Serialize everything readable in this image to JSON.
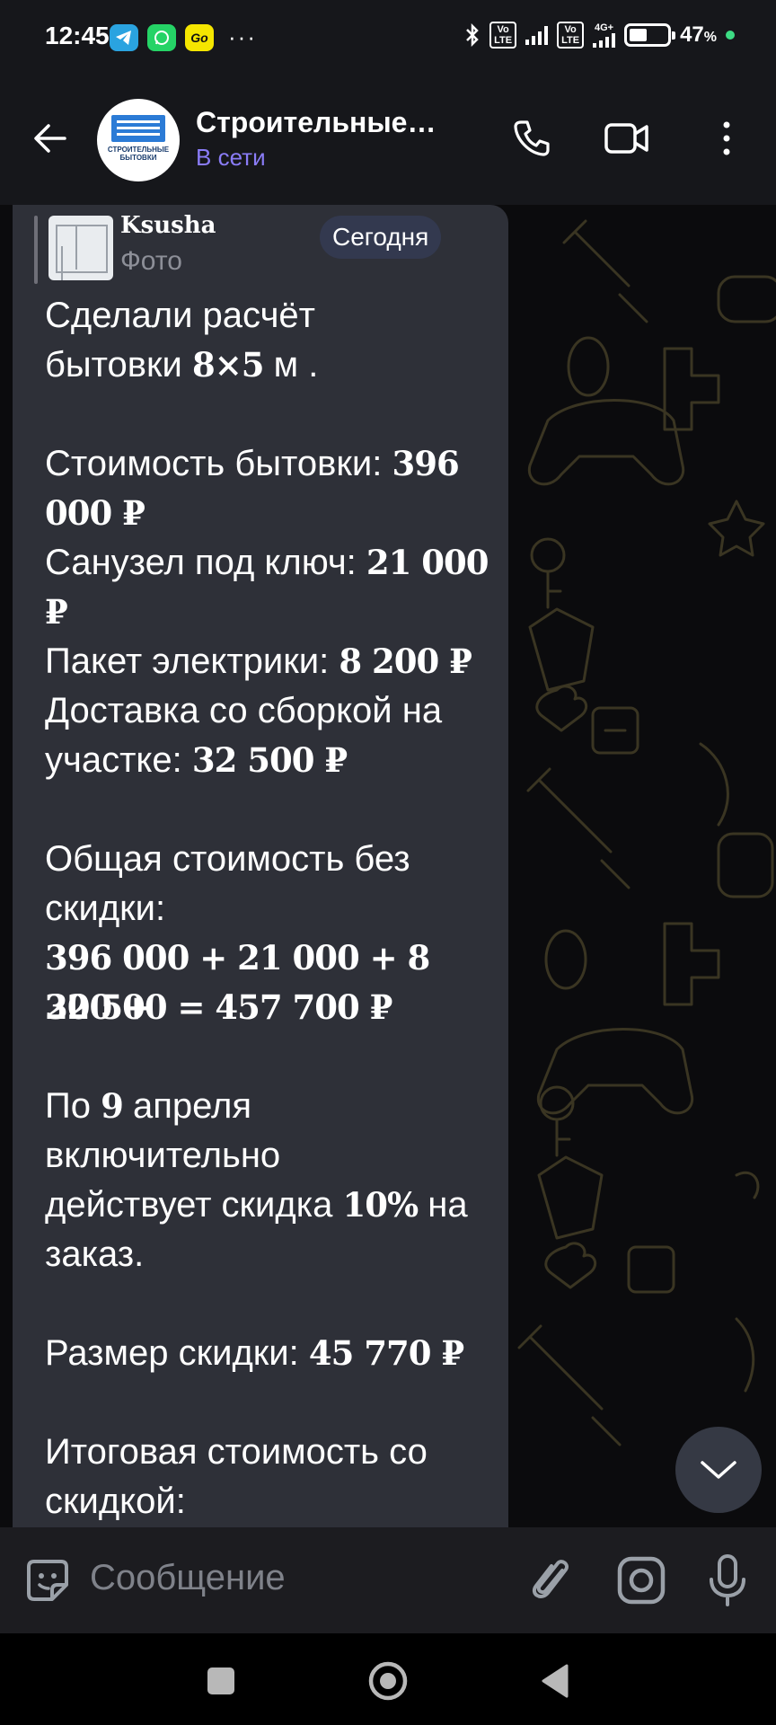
{
  "status_bar": {
    "time": "12:45",
    "battery_percent": "47",
    "battery_suffix": "%",
    "battery_level": 0.47,
    "volte_1": "Vo\nLTE",
    "volte_2": "Vo\nLTE",
    "network": "4G+",
    "app_icons": [
      "telegram-icon",
      "whatsapp-icon",
      "go-icon"
    ],
    "overflow": "···"
  },
  "header": {
    "title": "Строительные…",
    "status": "В сети",
    "avatar_text": "СТРОИТЕЛЬНЫЕ БЫТОВКИ",
    "accent_color": "#8a7cf7"
  },
  "message": {
    "reply": {
      "author": "Ksusha",
      "type": "Фото"
    },
    "date_badge": "Сегодня",
    "lines": [
      {
        "parts": [
          {
            "t": "Сделали расчёт"
          }
        ]
      },
      {
        "parts": [
          {
            "t": "бытовки "
          },
          {
            "t": "8×5",
            "b": true
          },
          {
            "t": " м ."
          }
        ]
      },
      {
        "parts": [
          {
            "t": ""
          }
        ]
      },
      {
        "parts": [
          {
            "t": "Стоимость бытовки: "
          },
          {
            "t": "396",
            "b": true
          }
        ]
      },
      {
        "parts": [
          {
            "t": "000 ₽",
            "b": true
          }
        ]
      },
      {
        "parts": [
          {
            "t": "Санузел под ключ: "
          },
          {
            "t": "21 000",
            "b": true
          }
        ]
      },
      {
        "parts": [
          {
            "t": "₽",
            "b": true
          }
        ]
      },
      {
        "parts": [
          {
            "t": "Пакет электрики: "
          },
          {
            "t": "8 200 ₽",
            "b": true
          }
        ]
      },
      {
        "parts": [
          {
            "t": "Доставка со сборкой на"
          }
        ]
      },
      {
        "parts": [
          {
            "t": "участке: "
          },
          {
            "t": "32 500 ₽",
            "b": true
          }
        ]
      },
      {
        "parts": [
          {
            "t": ""
          }
        ]
      },
      {
        "parts": [
          {
            "t": "Общая стоимость без"
          }
        ]
      },
      {
        "parts": [
          {
            "t": "скидки:"
          }
        ]
      },
      {
        "parts": [
          {
            "t": "396 000 + 21 000 + 8 200 +",
            "b": true
          }
        ]
      },
      {
        "parts": [
          {
            "t": "32 500 = 457 700 ₽",
            "b": true
          }
        ]
      },
      {
        "parts": [
          {
            "t": ""
          }
        ]
      },
      {
        "parts": [
          {
            "t": "По "
          },
          {
            "t": "9",
            "b": true
          },
          {
            "t": " апреля"
          }
        ]
      },
      {
        "parts": [
          {
            "t": "включительно"
          }
        ]
      },
      {
        "parts": [
          {
            "t": "действует скидка "
          },
          {
            "t": "10%",
            "b": true
          },
          {
            "t": " на"
          }
        ]
      },
      {
        "parts": [
          {
            "t": "заказ."
          }
        ]
      },
      {
        "parts": [
          {
            "t": ""
          }
        ]
      },
      {
        "parts": [
          {
            "t": "Размер скидки: "
          },
          {
            "t": "45 770 ₽",
            "b": true
          }
        ]
      },
      {
        "parts": [
          {
            "t": ""
          }
        ]
      },
      {
        "parts": [
          {
            "t": "Итоговая стоимость со"
          }
        ]
      },
      {
        "parts": [
          {
            "t": "скидкой:"
          }
        ]
      }
    ]
  },
  "composer": {
    "placeholder": "Сообщение"
  },
  "colors": {
    "bubble": "#2e3038",
    "accent": "#8a7cf7",
    "background": "#0b0b0d"
  }
}
